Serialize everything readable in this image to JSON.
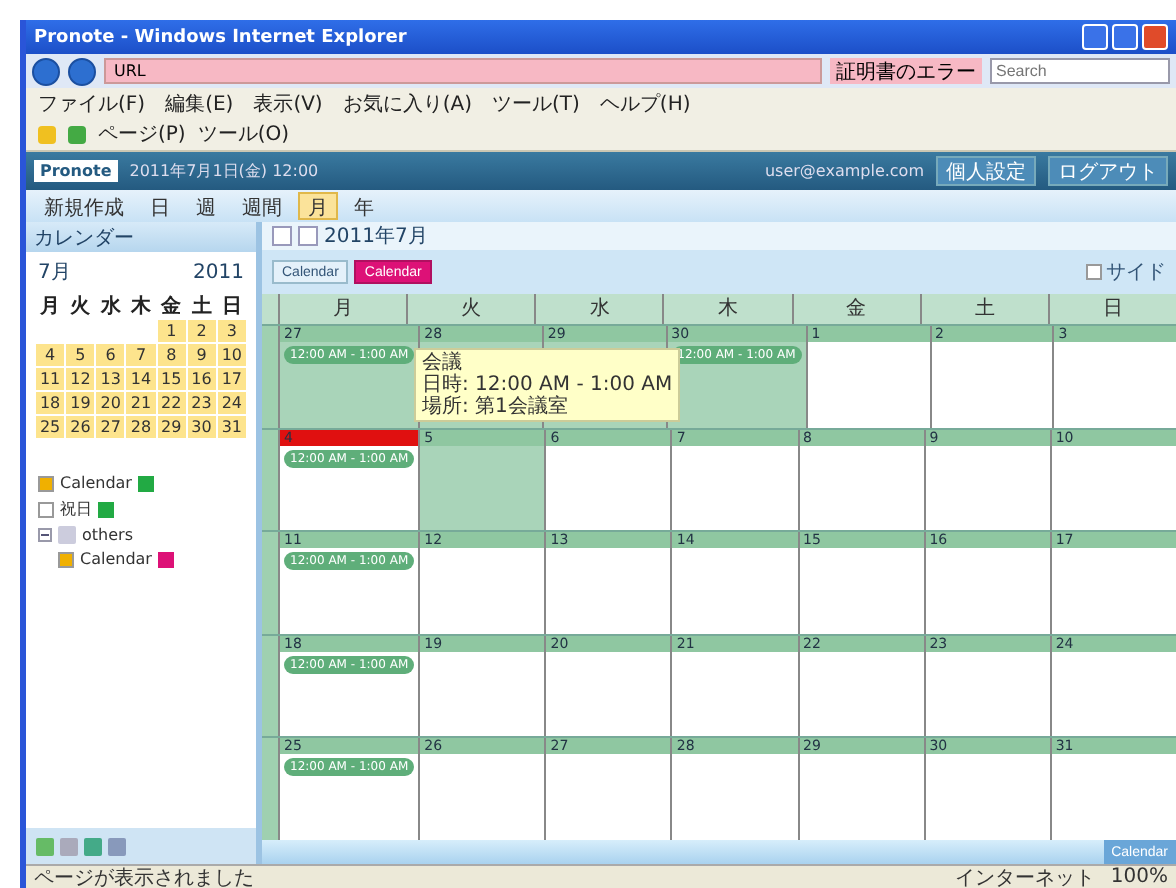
{
  "window": {
    "title": "Pronote - Windows Internet Explorer"
  },
  "address_bar": {
    "value": "URL",
    "status": "証明書のエラー",
    "search_placeholder": "Search"
  },
  "menu": [
    "ファイル(F)",
    "編集(E)",
    "表示(V)",
    "お気に入り(A)",
    "ツール(T)",
    "ヘルプ(H)"
  ],
  "command_bar": [
    "ページ(P)",
    "ツール(O)"
  ],
  "app_header": {
    "logo": "Pronote",
    "subtitle": "2011年7月1日(金) 12:00",
    "user": "user@example.com",
    "buttons": [
      "個人設定",
      "ログアウト"
    ]
  },
  "app_toolbar": [
    {
      "label": "新規作成",
      "selected": false
    },
    {
      "label": "日",
      "selected": false
    },
    {
      "label": "週",
      "selected": false
    },
    {
      "label": "週間",
      "selected": false
    },
    {
      "label": "月",
      "selected": true
    },
    {
      "label": "年",
      "selected": false
    }
  ],
  "sidebar": {
    "title": "カレンダー",
    "month": "7月",
    "year": "2011",
    "weekdays": [
      "月",
      "火",
      "水",
      "木",
      "金",
      "土",
      "日"
    ],
    "weeks": [
      [
        "1",
        "2",
        "3"
      ],
      [
        "4",
        "5",
        "6",
        "7",
        "8",
        "9",
        "10"
      ],
      [
        "11",
        "12",
        "13",
        "14",
        "15",
        "16",
        "17"
      ],
      [
        "18",
        "19",
        "20",
        "21",
        "22",
        "23",
        "24"
      ],
      [
        "25",
        "26",
        "27",
        "28",
        "29",
        "30",
        "31"
      ]
    ],
    "calendars": [
      {
        "label": "Calendar",
        "checked": true,
        "color": "#22aa44"
      },
      {
        "label": "祝日",
        "checked": false,
        "color": "#22aa44"
      },
      {
        "label": "others",
        "expanded": true,
        "children": [
          {
            "label": "Calendar",
            "checked": true,
            "color": "#dd1177"
          }
        ]
      }
    ]
  },
  "main": {
    "title": "2011年7月",
    "legend": [
      {
        "label": "Calendar",
        "selected": false
      },
      {
        "label": "Calendar",
        "selected": true
      }
    ],
    "option": {
      "label": "サイド",
      "checked": false
    },
    "weekdays": [
      "月",
      "火",
      "水",
      "木",
      "金",
      "土",
      "日"
    ],
    "weeks": [
      {
        "days": [
          {
            "date": "27",
            "shaded": true,
            "today": false,
            "events": [
              "12:00 AM - 1:00 AM"
            ]
          },
          {
            "date": "28",
            "shaded": true,
            "today": false
          },
          {
            "date": "29",
            "shaded": true,
            "today": false
          },
          {
            "date": "30",
            "shaded": true,
            "today": false,
            "events": [
              "12:00 AM - 1:00 AM"
            ]
          },
          {
            "date": "1",
            "shaded": false,
            "today": false
          },
          {
            "date": "2",
            "shaded": false,
            "today": false
          },
          {
            "date": "3",
            "shaded": false,
            "today": false
          }
        ]
      },
      {
        "days": [
          {
            "date": "4",
            "shaded": false,
            "today": true,
            "events": [
              "12:00 AM - 1:00 AM"
            ]
          },
          {
            "date": "5",
            "shaded": true,
            "today": false
          },
          {
            "date": "6",
            "shaded": false,
            "today": false
          },
          {
            "date": "7",
            "shaded": false,
            "today": false
          },
          {
            "date": "8",
            "shaded": false,
            "today": false
          },
          {
            "date": "9",
            "shaded": false,
            "today": false
          },
          {
            "date": "10",
            "shaded": false,
            "today": false
          }
        ]
      },
      {
        "days": [
          {
            "date": "11",
            "shaded": false,
            "today": false,
            "events": [
              "12:00 AM - 1:00 AM"
            ]
          },
          {
            "date": "12",
            "shaded": false,
            "today": false
          },
          {
            "date": "13",
            "shaded": false,
            "today": false
          },
          {
            "date": "14",
            "shaded": false,
            "today": false
          },
          {
            "date": "15",
            "shaded": false,
            "today": false
          },
          {
            "date": "16",
            "shaded": false,
            "today": false
          },
          {
            "date": "17",
            "shaded": false,
            "today": false
          }
        ]
      },
      {
        "days": [
          {
            "date": "18",
            "shaded": false,
            "today": false,
            "events": [
              "12:00 AM - 1:00 AM"
            ]
          },
          {
            "date": "19",
            "shaded": false,
            "today": false
          },
          {
            "date": "20",
            "shaded": false,
            "today": false
          },
          {
            "date": "21",
            "shaded": false,
            "today": false
          },
          {
            "date": "22",
            "shaded": false,
            "today": false
          },
          {
            "date": "23",
            "shaded": false,
            "today": false
          },
          {
            "date": "24",
            "shaded": false,
            "today": false
          }
        ]
      },
      {
        "days": [
          {
            "date": "25",
            "shaded": false,
            "today": false,
            "events": [
              "12:00 AM - 1:00 AM"
            ]
          },
          {
            "date": "26",
            "shaded": false,
            "today": false
          },
          {
            "date": "27",
            "shaded": false,
            "today": false
          },
          {
            "date": "28",
            "shaded": false,
            "today": false
          },
          {
            "date": "29",
            "shaded": false,
            "today": false
          },
          {
            "date": "30",
            "shaded": false,
            "today": false
          },
          {
            "date": "31",
            "shaded": false,
            "today": false
          }
        ]
      }
    ],
    "tooltip": {
      "title": "会議",
      "lines": [
        "日時: 12:00 AM - 1:00 AM",
        "場所: 第1会議室"
      ]
    },
    "footer_button": "Calendar"
  },
  "status_bar": {
    "left": "ページが表示されました",
    "zone": "インターネット",
    "zoom": "100%"
  }
}
